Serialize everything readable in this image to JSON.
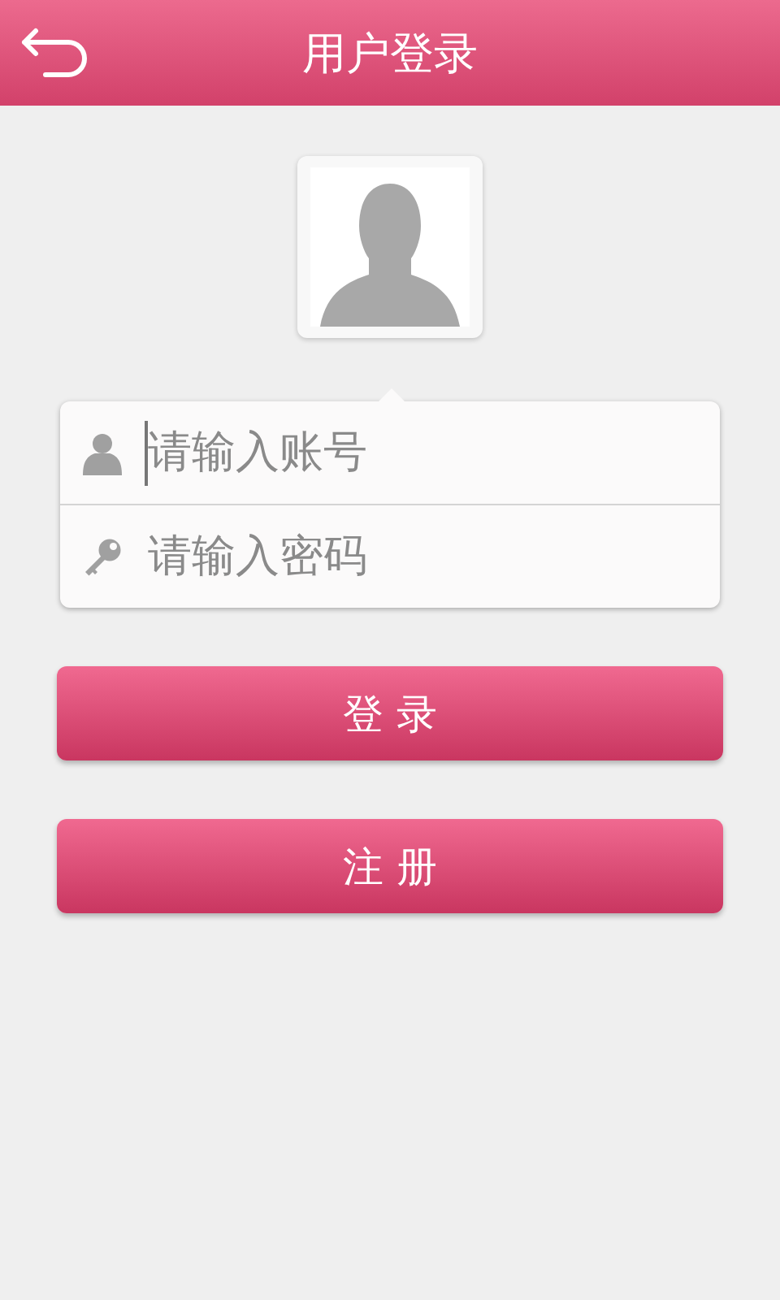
{
  "header": {
    "title": "用户登录"
  },
  "form": {
    "fields": [
      {
        "kind": "account",
        "placeholder": "请输入账号",
        "focused": true
      },
      {
        "kind": "password",
        "placeholder": "请输入密码",
        "focused": false
      }
    ]
  },
  "buttons": [
    "登 录",
    "注 册"
  ]
}
